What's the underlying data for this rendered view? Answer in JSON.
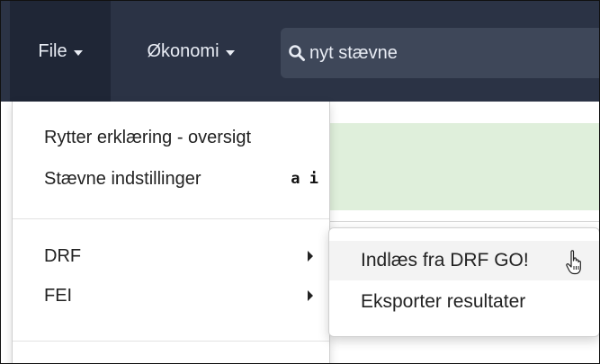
{
  "navbar": {
    "file_label": "File",
    "okonomi_label": "Økonomi",
    "search_text": "nyt stævne"
  },
  "file_menu": {
    "items": [
      {
        "label": "Rytter erklæring - oversigt"
      },
      {
        "label": "Stævne indstillinger",
        "shortcut": "a i"
      },
      {
        "label": "DRF",
        "submenu": true
      },
      {
        "label": "FEI",
        "submenu": true
      }
    ]
  },
  "drf_submenu": {
    "items": [
      {
        "label": "Indlæs fra DRF GO!"
      },
      {
        "label": "Eksporter resultater"
      }
    ]
  },
  "colors": {
    "navbar_bg": "#2b3345",
    "nav_active_bg": "#1f2636",
    "alert_green": "#dfefdb"
  },
  "icons": [
    "search-icon",
    "caret-down-icon",
    "chevron-right-icon",
    "hand-pointer-icon"
  ]
}
